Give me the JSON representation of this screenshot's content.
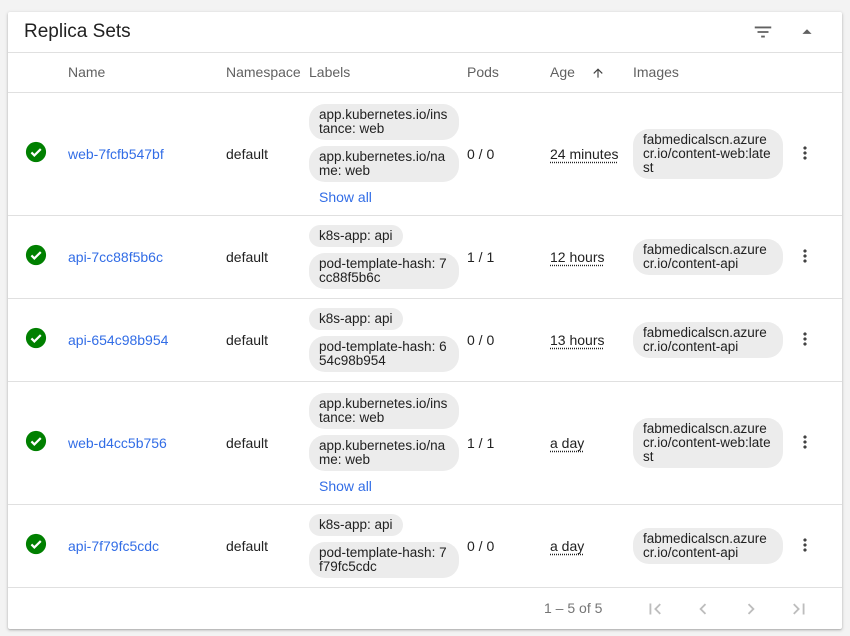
{
  "card": {
    "title": "Replica Sets"
  },
  "columns": {
    "name": "Name",
    "namespace": "Namespace",
    "labels": "Labels",
    "pods": "Pods",
    "age": "Age",
    "images": "Images"
  },
  "rows": [
    {
      "name": "web-7fcfb547bf",
      "namespace": "default",
      "labels": [
        "app.kubernetes.io/instance: web",
        "app.kubernetes.io/name: web"
      ],
      "show_all": "Show all",
      "pods": "0 / 0",
      "age": "24 minutes",
      "image": "fabmedicalscn.azurecr.io/content-web:latest"
    },
    {
      "name": "api-7cc88f5b6c",
      "namespace": "default",
      "labels": [
        "k8s-app: api",
        "pod-template-hash: 7cc88f5b6c"
      ],
      "pods": "1 / 1",
      "age": "12 hours",
      "image": "fabmedicalscn.azurecr.io/content-api"
    },
    {
      "name": "api-654c98b954",
      "namespace": "default",
      "labels": [
        "k8s-app: api",
        "pod-template-hash: 654c98b954"
      ],
      "pods": "0 / 0",
      "age": "13 hours",
      "image": "fabmedicalscn.azurecr.io/content-api"
    },
    {
      "name": "web-d4cc5b756",
      "namespace": "default",
      "labels": [
        "app.kubernetes.io/instance: web",
        "app.kubernetes.io/name: web"
      ],
      "show_all": "Show all",
      "pods": "1 / 1",
      "age": "a day",
      "image": "fabmedicalscn.azurecr.io/content-web:latest"
    },
    {
      "name": "api-7f79fc5cdc",
      "namespace": "default",
      "labels": [
        "k8s-app: api",
        "pod-template-hash: 7f79fc5cdc"
      ],
      "pods": "0 / 0",
      "age": "a day",
      "image": "fabmedicalscn.azurecr.io/content-api"
    }
  ],
  "footer": {
    "range": "1 – 5 of 5"
  },
  "icons": {
    "status": "check-circle-icon",
    "filter": "filter-icon",
    "collapse": "caret-up-icon",
    "sort": "arrow-up-icon",
    "more": "more-vert-icon",
    "first": "first-page-icon",
    "prev": "chevron-left-icon",
    "next": "chevron-right-icon",
    "last": "last-page-icon"
  },
  "colors": {
    "success": "#008000",
    "link": "#326de6",
    "chip": "#ececec"
  }
}
